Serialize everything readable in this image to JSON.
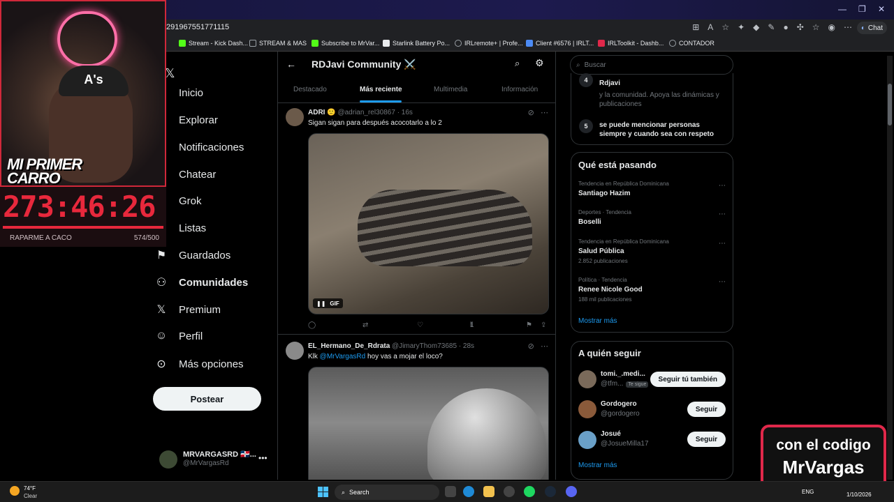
{
  "browser": {
    "url": "291967551771115",
    "chat_label": "Chat",
    "bookmarks": [
      {
        "label": "Stream - Kick Dash...",
        "color": "#53fc18"
      },
      {
        "label": "STREAM & MAS",
        "color": "#9aa0a6"
      },
      {
        "label": "Subscribe to MrVar...",
        "color": "#53fc18"
      },
      {
        "label": "Starlink Battery Po...",
        "color": "#e8eaed"
      },
      {
        "label": "IRLremote+ | Profe...",
        "color": "#9aa0a6"
      },
      {
        "label": "Client #6576 | IRLT...",
        "color": "#4c8bf5"
      },
      {
        "label": "IRLToolkit - Dashb...",
        "color": "#e0284a"
      },
      {
        "label": "CONTADOR",
        "color": "#9aa0a6"
      }
    ]
  },
  "stream_overlay": {
    "caption": "MI PRIMER CARRO",
    "cap_text": "A's",
    "timer": "273:46:26",
    "goal_label": "RAPARME A CACO",
    "goal_count": "574/500",
    "goal_progress": 1.0,
    "promo_line1": "con el codigo",
    "promo_line2": "MrVargas"
  },
  "nav": {
    "items": [
      {
        "label": "Inicio",
        "icon": "home-icon"
      },
      {
        "label": "Explorar",
        "icon": "search-icon"
      },
      {
        "label": "Notificaciones",
        "icon": "bell-icon"
      },
      {
        "label": "Chatear",
        "icon": "chat-icon"
      },
      {
        "label": "Grok",
        "icon": "grok-icon"
      },
      {
        "label": "Listas",
        "icon": "list-icon"
      },
      {
        "label": "Guardados",
        "icon": "bookmark-icon"
      },
      {
        "label": "Comunidades",
        "icon": "communities-icon"
      },
      {
        "label": "Premium",
        "icon": "x-logo-icon"
      },
      {
        "label": "Perfil",
        "icon": "profile-icon"
      },
      {
        "label": "Más opciones",
        "icon": "more-icon"
      }
    ],
    "post_label": "Postear",
    "account_name": "MRVARGASRD 🇩🇴...",
    "account_handle": "@MrVargasRd"
  },
  "community": {
    "title": "RDJavi Community ⚔️",
    "tabs": [
      "Destacado",
      "Más reciente",
      "Multimedia",
      "Información"
    ],
    "active_tab": "Más reciente"
  },
  "tweets": [
    {
      "name": "ADRI 🙂",
      "handle": "@adrian_rel30867",
      "time": "16s",
      "text": "Sigan sigan para después acocotarlo a lo 2",
      "media_badge": "GIF",
      "views": "1"
    },
    {
      "name": "EL_Hermano_De_Rdrata",
      "handle": "@JimaryThom73685",
      "time": "28s",
      "text_prefix": "Klk ",
      "mention": "@MrVargasRd",
      "text_suffix": " hoy vas a mojar el loco?"
    }
  ],
  "right": {
    "search_placeholder": "Buscar",
    "rules": [
      {
        "num": "4",
        "title": "Rdjavi",
        "desc": "y la comunidad. Apoya las dinámicas y publicaciones"
      },
      {
        "num": "5",
        "title": "se puede mencionar personas siempre y cuando sea con respeto"
      }
    ],
    "trends_title": "Qué está pasando",
    "trends": [
      {
        "meta": "Tendencia en República Dominicana",
        "name": "Santiago Hazim",
        "count": ""
      },
      {
        "meta": "Deportes · Tendencia",
        "name": "Boselli",
        "count": ""
      },
      {
        "meta": "Tendencia en República Dominicana",
        "name": "Salud Pública",
        "count": "2.852 publicaciones"
      },
      {
        "meta": "Política · Tendencia",
        "name": "Renee Nicole Good",
        "count": "188 mil publicaciones"
      }
    ],
    "show_more": "Mostrar más",
    "follow_title": "A quién seguir",
    "follow": [
      {
        "name": "tomi._.medi...",
        "handle": "@tfm...",
        "badge": "Te sigue",
        "button": "Seguir tú también",
        "color": "#7a6a5a"
      },
      {
        "name": "Gordogero",
        "handle": "@gordogero",
        "badge": "",
        "button": "Seguir",
        "color": "#8a5a3a"
      },
      {
        "name": "Josué",
        "handle": "@JosueMilla17",
        "badge": "",
        "button": "Seguir",
        "color": "#6aa0c8"
      }
    ]
  },
  "taskbar": {
    "temp": "74°F",
    "condition": "Clear",
    "search": "Search",
    "lang": "ENG",
    "date": "1/10/2026"
  }
}
